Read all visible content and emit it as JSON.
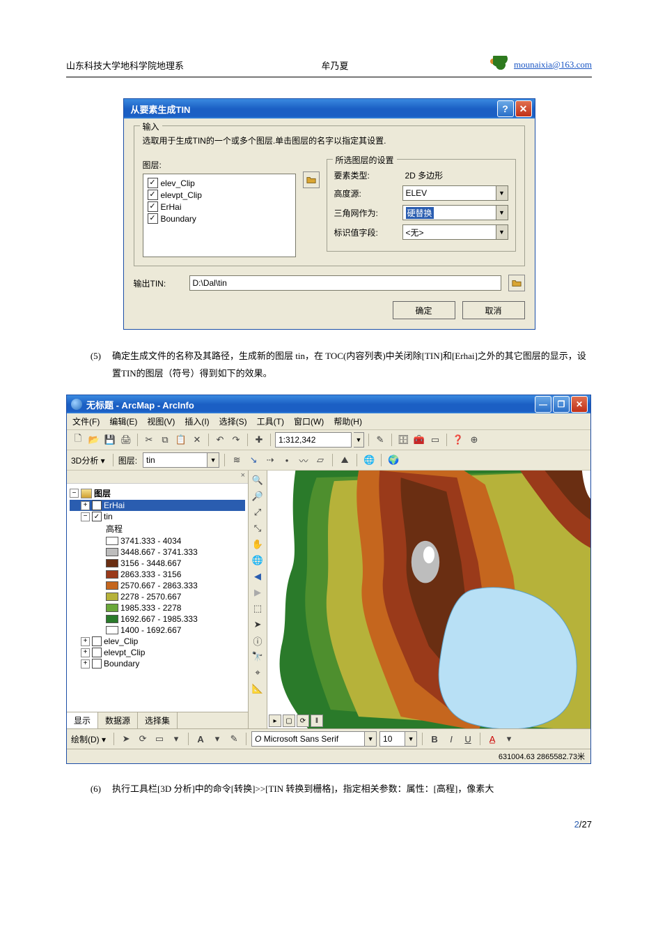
{
  "header": {
    "left": "山东科技大学地科学院地理系",
    "center": "牟乃夏",
    "email": "mounaixia@163.com"
  },
  "dialog": {
    "title": "从要素生成TIN",
    "group_input_legend": "输入",
    "instruction": "选取用于生成TIN的一个或多个图层.单击图层的名字以指定其设置.",
    "layer_label": "图层:",
    "layers": [
      "elev_Clip",
      "elevpt_Clip",
      "ErHai",
      "Boundary"
    ],
    "settings_legend": "所选图层的设置",
    "feat_type_label": "要素类型:",
    "feat_type_value": "2D 多边形",
    "height_label": "高度源:",
    "height_value": "ELEV",
    "tri_label": "三角网作为:",
    "tri_value": "硬替换",
    "tag_label": "标识值字段:",
    "tag_value": "<无>",
    "out_label": "输出TIN:",
    "out_value": "D:\\Dal\\tin",
    "ok": "确定",
    "cancel": "取消"
  },
  "para5": {
    "num": "(5)",
    "text": "确定生成文件的名称及其路径，生成新的图层 tin，在 TOC(内容列表)中关闭除[TIN]和[Erhai]之外的其它图层的显示，设置TIN的图层（符号）得到如下的效果。"
  },
  "app": {
    "title": "无标题 - ArcMap - ArcInfo",
    "menus": [
      "文件(F)",
      "编辑(E)",
      "视图(V)",
      "插入(I)",
      "选择(S)",
      "工具(T)",
      "窗口(W)",
      "帮助(H)"
    ],
    "scale": "1:312,342",
    "analysis_label": "3D分析",
    "layer_label": "图层:",
    "layer_value": "tin",
    "toc_root": "图层",
    "toc_erhai": "ErHai",
    "toc_tin": "tin",
    "toc_elev_title": "高程",
    "legend": [
      {
        "label": "3741.333 - 4034",
        "color": "#ffffff"
      },
      {
        "label": "3448.667 - 3741.333",
        "color": "#bdbdbd"
      },
      {
        "label": "3156 - 3448.667",
        "color": "#6a2e12"
      },
      {
        "label": "2863.333 - 3156",
        "color": "#9a3a1a"
      },
      {
        "label": "2570.667 - 2863.333",
        "color": "#c5661e"
      },
      {
        "label": "2278 - 2570.667",
        "color": "#b6b23a"
      },
      {
        "label": "1985.333 - 2278",
        "color": "#6aa83a"
      },
      {
        "label": "1692.667 - 1985.333",
        "color": "#2a7a2a"
      },
      {
        "label": "1400 - 1692.667",
        "color": "#ffffff"
      }
    ],
    "toc_unchecked": [
      "elev_Clip",
      "elevpt_Clip",
      "Boundary"
    ],
    "toc_tabs": [
      "显示",
      "数据源",
      "选择集"
    ],
    "draw_label": "绘制(D)",
    "font_name": "Microsoft Sans Serif",
    "font_size": "10",
    "status_coords": "631004.63 2865582.73米"
  },
  "para6": {
    "num": "(6)",
    "text": "执行工具栏[3D 分析]中的命令[转换]>>[TIN 转换到栅格]，指定相关参数：属性：[高程]，像素大"
  },
  "footer": {
    "page": "2",
    "total": "27"
  }
}
